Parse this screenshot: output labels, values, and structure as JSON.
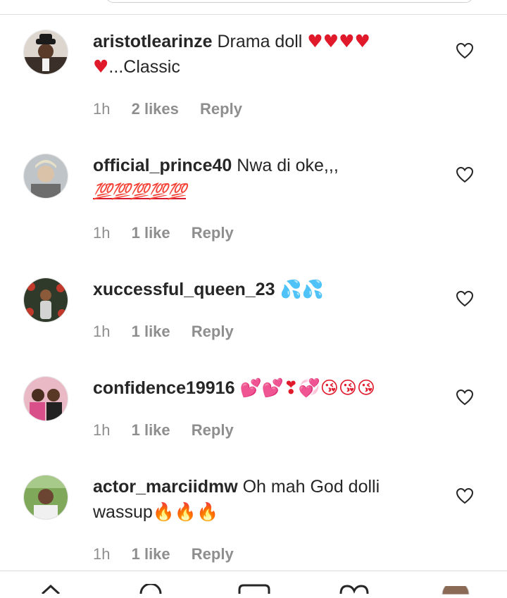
{
  "comments": [
    {
      "username": "aristotlearinze",
      "text_before": "Drama doll ",
      "emoji": "♥♥♥♥ ♥",
      "text_after": "...Classic",
      "time": "1h",
      "likes": "2 likes",
      "reply": "Reply",
      "avatar_icon": "avatar-man-hat"
    },
    {
      "username": "official_prince40",
      "text_before": "Nwa di oke,,,",
      "emoji": "💯💯💯💯💯",
      "text_after": "",
      "time": "1h",
      "likes": "1 like",
      "reply": "Reply",
      "avatar_icon": "avatar-man"
    },
    {
      "username": "xuccessful_queen_23",
      "text_before": "",
      "emoji": "💦💦",
      "text_after": "",
      "time": "1h",
      "likes": "1 like",
      "reply": "Reply",
      "avatar_icon": "avatar-woman-roses"
    },
    {
      "username": "confidence19916",
      "text_before": "",
      "emoji": "💕💕❣💞😘😘😘",
      "text_after": "",
      "time": "1h",
      "likes": "1 like",
      "reply": "Reply",
      "avatar_icon": "avatar-women"
    },
    {
      "username": "actor_marciidmw",
      "text_before": "Oh mah God dolli wassup",
      "emoji": "🔥🔥🔥",
      "text_after": "",
      "time": "1h",
      "likes": "1 like",
      "reply": "Reply",
      "avatar_icon": "avatar-man-outdoor"
    }
  ],
  "icons": {
    "like": "heart-outline-icon",
    "nav": [
      "home-icon",
      "search-icon",
      "reels-icon",
      "activity-heart-icon",
      "profile-avatar-icon"
    ]
  },
  "colors": {
    "text": "#262626",
    "meta": "#8e8e8e",
    "emoji_red": "#e0192b"
  }
}
